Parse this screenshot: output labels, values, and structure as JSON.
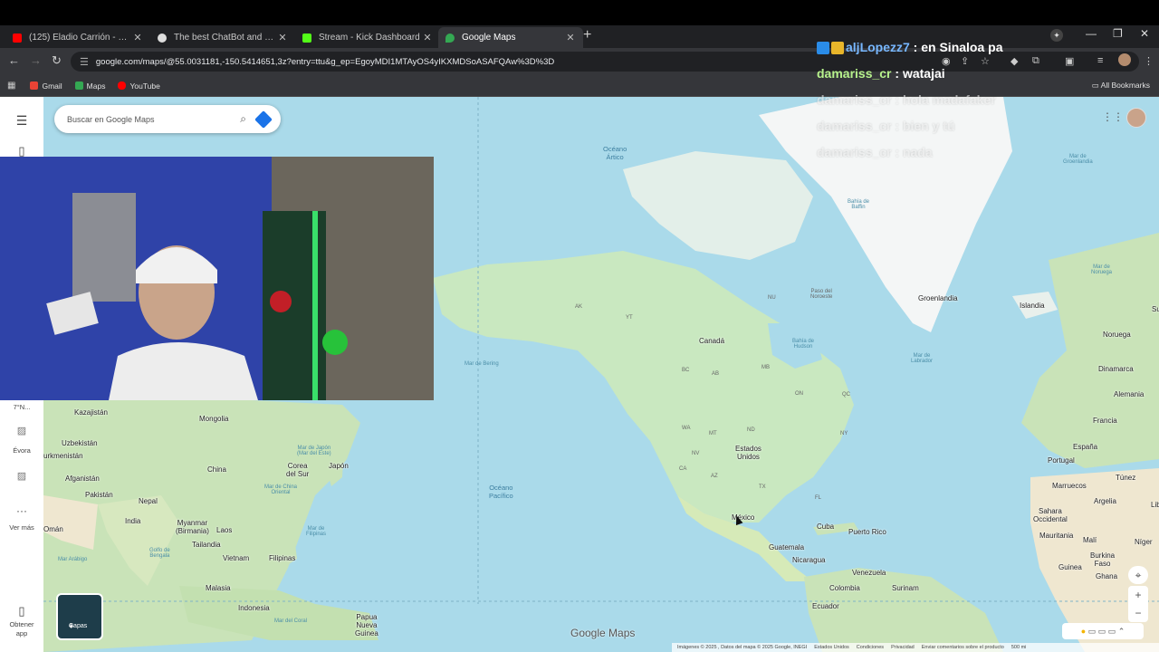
{
  "browser": {
    "tabs": [
      {
        "title": "(125) Eladio Carrión - Mbappe",
        "color": "#ff0000"
      },
      {
        "title": "The best ChatBot and Widgets",
        "color": "#dddddd"
      },
      {
        "title": "Stream - Kick Dashboard",
        "color": "#53fc18"
      },
      {
        "title": "Google Maps",
        "color": "#34a853"
      }
    ],
    "active_tab": 3,
    "url": "google.com/maps/@55.0031181,-150.5414651,3z?entry=ttu&g_ep=EgoyMDI1MTAyOS4yIKXMDSoASAFQAw%3D%3D",
    "bookmarks": [
      "Gmail",
      "Maps",
      "YouTube"
    ],
    "all_bookmarks": "All Bookmarks"
  },
  "maps": {
    "search_placeholder": "Buscar en Google Maps",
    "sidebar": {
      "partial_label": "7°N...",
      "evora": "Évora",
      "more": "Ver más",
      "get_app_1": "Obtener",
      "get_app_2": "app"
    },
    "layers_label": "Capas",
    "logo": "Google Maps",
    "footer": [
      "Imágenes © 2025 , Datos del mapa © 2025 Google, INEGI",
      "Estados Unidos",
      "Condiciones",
      "Privacidad",
      "Enviar comentarios sobre el producto",
      "500 mi"
    ],
    "countries": {
      "canada": "Canadá",
      "usa_1": "Estados",
      "usa_2": "Unidos",
      "mexico": "México",
      "greenland": "Groenlandia",
      "iceland": "Islandia",
      "norway": "Noruega",
      "denmark": "Dinamarca",
      "germany": "Alemania",
      "france": "Francia",
      "spain": "España",
      "portugal": "Portugal",
      "tunisia": "Túnez",
      "morocco": "Marruecos",
      "algeria": "Argelia",
      "wsahara_1": "Sahara",
      "wsahara_2": "Occidental",
      "mauritania": "Mauritania",
      "mali": "Malí",
      "niger": "Níger",
      "burkina_1": "Burkina",
      "burkina_2": "Faso",
      "guinea": "Guinea",
      "ghana": "Ghana",
      "cuba": "Cuba",
      "puerto_rico": "Puerto Rico",
      "guatemala": "Guatemala",
      "nicaragua": "Nicaragua",
      "venezuela": "Venezuela",
      "colombia": "Colombia",
      "suriname": "Surinam",
      "ecuador": "Ecuador",
      "kazakhstan": "Kazajistán",
      "mongolia": "Mongolia",
      "uzbekistan": "Uzbekistán",
      "turkmenistan": "urkmenistán",
      "afghanistan": "Afganistán",
      "pakistan": "Pakistán",
      "china": "China",
      "south_korea_1": "Corea",
      "south_korea_2": "del Sur",
      "japan": "Japón",
      "nepal": "Nepal",
      "india": "India",
      "oman": "Omán",
      "myanmar_1": "Myanmar",
      "myanmar_2": "(Birmania)",
      "laos": "Laos",
      "thailand": "Tailandia",
      "vietnam": "Vietnam",
      "philippines": "Filipinas",
      "malaysia": "Malasia",
      "indonesia": "Indonesia",
      "png_1": "Papua",
      "png_2": "Nueva",
      "png_3": "Guinea",
      "sweden_partial": "Suec",
      "libya_partial": "Lib"
    },
    "waters": {
      "arctic_1": "Océano",
      "arctic_2": "Ártico",
      "pacific_1": "Océano",
      "pacific_2": "Pacífico",
      "bering": "Mar de Bering",
      "baffin_1": "Bahía de",
      "baffin_2": "Baffin",
      "hudson_1": "Bahía de",
      "hudson_2": "Hudson",
      "labrador_1": "Mar de",
      "labrador_2": "Labrador",
      "greenland_sea_1": "Mar de",
      "greenland_sea_2": "Groenlandia",
      "norwegian_1": "Mar de",
      "norwegian_2": "Noruega",
      "japan_sea_1": "Mar de Japón",
      "japan_sea_2": "(Mar del Este)",
      "east_china_1": "Mar de China",
      "east_china_2": "Oriental",
      "philippine_1": "Mar de",
      "philippine_2": "Filipinas",
      "arabian": "Mar Arábigo",
      "bengal_1": "Golfo de",
      "bengal_2": "Bengala",
      "coral": "Mar del Coral",
      "northwest_1": "Paso del",
      "northwest_2": "Noroeste"
    },
    "regions": {
      "ak": "AK",
      "yt": "YT",
      "nu": "NU",
      "bc": "BC",
      "ab": "AB",
      "mb": "MB",
      "on": "ON",
      "qc": "QC",
      "wa": "WA",
      "mt": "MT",
      "nd": "ND",
      "nv": "NV",
      "ca": "CA",
      "az": "AZ",
      "tx": "TX",
      "ny": "NY",
      "fl": "FL"
    }
  },
  "stream_chat": [
    {
      "user": "aljLopezz7",
      "message": " : en Sinaloa pa",
      "faded": false
    },
    {
      "user": "damariss_cr",
      "message": " : watajai",
      "faded": false
    },
    {
      "user": "damariss_cr",
      "message": " : hola madafaker",
      "faded": true
    },
    {
      "user": "damariss_cr",
      "message": " : bien y tú",
      "faded": true
    },
    {
      "user": "damariss_cr",
      "message": " : nada",
      "faded": true
    }
  ],
  "colors": {
    "water": "#aadaea",
    "land": "#c9e8c0",
    "ice": "#f4f6f6",
    "desert": "#f0e9d6",
    "chat_username": "#b7f28c"
  }
}
